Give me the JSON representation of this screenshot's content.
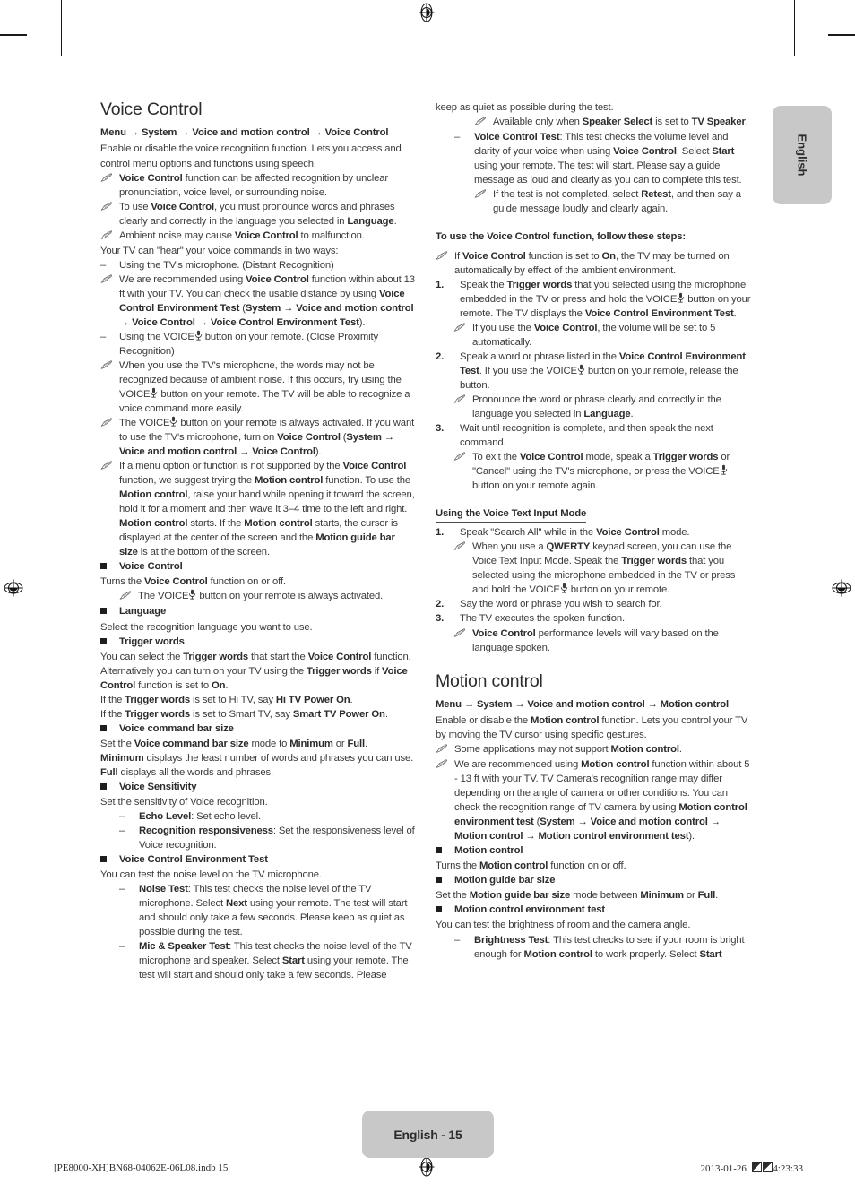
{
  "page": {
    "badge_label": "English - 15",
    "side_tab_label": "English",
    "footer_left": "[PE8000-XH]BN68-04062E-06L08.indb   15",
    "footer_date": "2013-01-26",
    "footer_time": "4:23:33"
  },
  "left_column": {
    "title": "Voice Control",
    "menu_path": "Menu → System → Voice and motion control → Voice Control",
    "intro": "Enable or disable the voice recognition function. Lets you access and control menu options and functions using speech.",
    "notes_intro": [
      "<b>Voice Control</b> function can be affected recognition by unclear pronunciation, voice level, or surrounding noise.",
      "To use <b>Voice Control</b>, you must pronounce words and phrases clearly and correctly in the language you selected in <b>Language</b>.",
      "Ambient noise may cause <b>Voice Control</b> to malfunction."
    ],
    "ways_lead": "Your TV can \"hear\" your voice commands in two ways:",
    "way1_dash": "Using the TV's microphone. (Distant Recognition)",
    "way1_note": "We are recommended using <b>Voice Control</b> function within about 13 ft with your TV. You can check the usable distance by using <b>Voice Control Environment Test</b> (<b>System → Voice and motion control → Voice Control → Voice Control Environment Test</b>).",
    "way2_dash": "Using the VOICE{MIC} button on your remote. (Close Proximity Recognition)",
    "way2_note": "When you use the TV's microphone, the words may not be recognized because of ambient noise. If this occurs, try using the VOICE{MIC} button on your remote. The TV will be able to recognize a voice command more easily.",
    "note_voice_btn": "The VOICE{MIC} button on your remote is always activated. If you want to use the TV's microphone, turn on <b>Voice Control</b> (<b>System → Voice and motion control → Voice Control</b>).",
    "note_motion": "If a menu option or function is not supported by the <b>Voice Control</b> function, we suggest trying the <b>Motion control</b> function. To use the <b>Motion control</b>, raise your hand while opening it toward the screen, hold it for a moment and then wave it 3–4 time to the left and right. <b>Motion control</b> starts. If the <b>Motion control</b> starts, the cursor is displayed at the center of the screen and the <b>Motion guide bar size</b> is at the bottom of the screen.",
    "items": [
      {
        "label": "Voice Control",
        "desc": "Turns the <b>Voice Control</b> function on or off.",
        "note": "The VOICE{MIC} button on your remote is always activated."
      },
      {
        "label": "Language",
        "desc": "Select the recognition language you want to use."
      },
      {
        "label": "Trigger words",
        "desc": "You can select the <b>Trigger words</b> that start the <b>Voice Control</b> function. Alternatively you can turn on your TV using the <b>Trigger words</b> if <b>Voice Control</b> function is set to <b>On</b>.",
        "desc2": "If the <b>Trigger words</b> is set to Hi TV, say <b>Hi TV Power On</b>.",
        "desc3": "If the <b>Trigger words</b> is set to Smart TV, say <b>Smart TV Power On</b>."
      },
      {
        "label": "Voice command bar size",
        "desc": "Set the <b>Voice command bar size</b> mode to <b>Minimum</b> or <b>Full</b>.",
        "desc2": "<b>Minimum</b> displays the least number of words and phrases you can use.",
        "desc3": "<b>Full</b> displays all the words and phrases."
      },
      {
        "label": "Voice Sensitivity",
        "desc": "Set the sensitivity of Voice recognition.",
        "subs": [
          "<b>Echo Level</b>: Set echo level.",
          "<b>Recognition responsiveness</b>: Set the responsiveness level of Voice recognition."
        ]
      },
      {
        "label": "Voice Control Environment Test",
        "desc": "You can test the noise level on the TV microphone.",
        "subs": [
          "<b>Noise Test</b>: This test checks the noise level of the TV microphone. Select <b>Next</b> using your remote. The test will start and should only take a few seconds. Please keep as quiet as possible during the test.",
          "<b>Mic &amp; Speaker Test</b>: This test checks the noise level of the TV microphone and speaker. Select <b>Start</b> using your remote. The test will start and should only take a few seconds. Please"
        ]
      }
    ]
  },
  "right_column": {
    "continued_text": "keep as quiet as possible during the test.",
    "continued_note": "Available only when <b>Speaker Select</b> is set to <b>TV Speaker</b>.",
    "voice_control_test": "<b>Voice Control Test</b>: This test checks the volume level and clarity of your voice when using <b>Voice Control</b>. Select <b>Start</b> using your remote. The test will start. Please say a guide message as loud and clearly as you can to complete this test.",
    "voice_control_test_note": "If the test is not completed, select <b>Retest</b>, and then say a guide message loudly and clearly again.",
    "steps_heading": "To use the Voice Control function, follow these steps:",
    "steps_note": "If <b>Voice Control</b> function is set to <b>On</b>, the TV may be turned on automatically by effect of the ambient environment.",
    "steps": [
      {
        "num": "1.",
        "text": "Speak the <b>Trigger words</b> that you selected using the microphone embedded in the TV or press and hold the VOICE{MIC} button on your remote. The TV displays the <b>Voice Control Environment Test</b>.",
        "note": "If you use the <b>Voice Control</b>, the volume will be set to 5 automatically."
      },
      {
        "num": "2.",
        "text": "Speak a word or phrase listed in the <b>Voice Control Environment Test</b>. If you use the VOICE{MIC} button on your remote, release the button.",
        "note": "Pronounce the word or phrase clearly and correctly in the language you selected in <b>Language</b>."
      },
      {
        "num": "3.",
        "text": "Wait until recognition is complete, and then speak the next command.",
        "note": "To exit the <b>Voice Control</b> mode, speak a <b>Trigger words</b> or \"Cancel\" using the TV's microphone, or press the VOICE{MIC} button on your remote again."
      }
    ],
    "text_input_heading": "Using the Voice Text Input Mode",
    "text_input_steps": [
      {
        "num": "1.",
        "text": "Speak \"Search All\" while in the <b>Voice Control</b> mode.",
        "note": "When you use a <b>QWERTY</b> keypad screen, you can use the Voice Text Input Mode. Speak the <b>Trigger words</b> that you selected using the microphone embedded in the TV or press and hold the VOICE{MIC} button on your remote."
      },
      {
        "num": "2.",
        "text": "Say the word or phrase you wish to search for."
      },
      {
        "num": "3.",
        "text": "The TV executes the spoken function.",
        "note": "<b>Voice Control</b> performance levels will vary based on the language spoken."
      }
    ],
    "motion_title": "Motion control",
    "motion_menu_path": "Menu → System → Voice and motion control → Motion control",
    "motion_intro": "Enable or disable the <b>Motion control</b> function. Lets you control your TV by moving the TV cursor using specific gestures.",
    "motion_notes": [
      "Some applications may not support <b>Motion control</b>.",
      "We are recommended using <b>Motion control</b> function within about 5 - 13 ft with your TV. TV Camera's recognition range may differ depending on the angle of camera or other conditions. You can check the recognition range of TV camera by using <b>Motion control environment test</b> (<b>System → Voice and motion control → Motion control → Motion control environment test</b>)."
    ],
    "motion_items": [
      {
        "label": "Motion control",
        "desc": "Turns the <b>Motion control</b> function on or off."
      },
      {
        "label": "Motion guide bar size",
        "desc": "Set the <b>Motion guide bar size</b> mode between <b>Minimum</b> or <b>Full</b>."
      },
      {
        "label": "Motion control environment test",
        "desc": "You can test the brightness of room and the camera angle.",
        "subs": [
          "<b>Brightness Test</b>: This test checks to see if your room is bright enough for <b>Motion control</b> to work properly. Select <b>Start</b>"
        ]
      }
    ]
  }
}
